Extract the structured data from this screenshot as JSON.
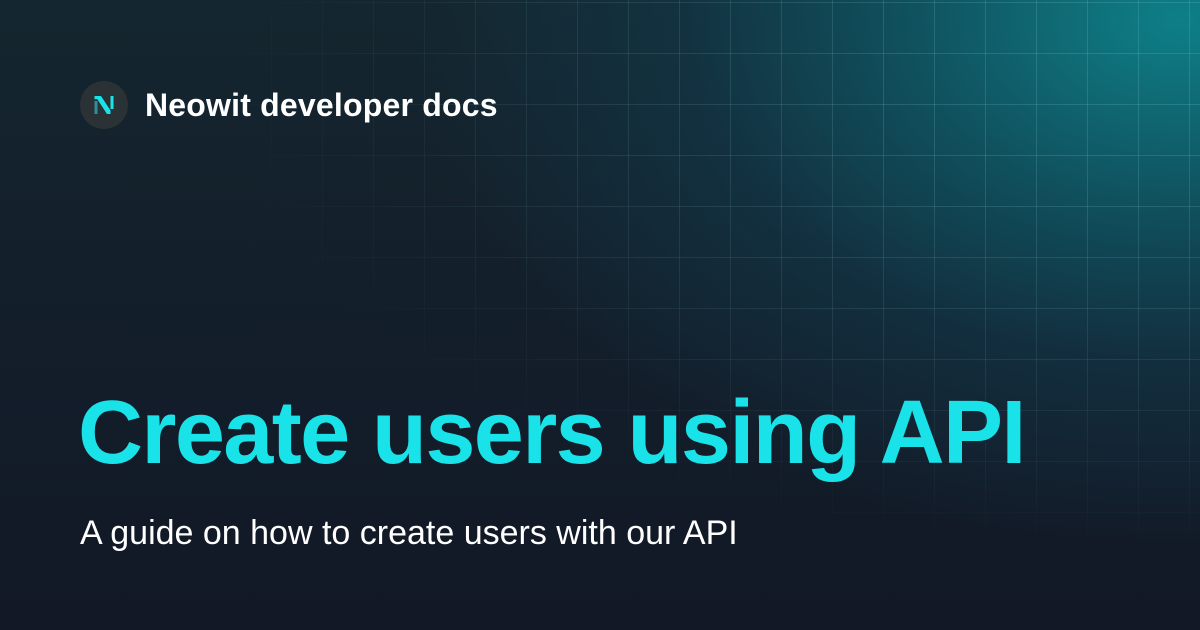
{
  "header": {
    "logo_icon": "neowit-logo-icon",
    "site_name": "Neowit developer docs"
  },
  "hero": {
    "title": "Create users using API",
    "subtitle": "A guide on how to create users with our API"
  },
  "colors": {
    "accent": "#19e3e8",
    "background": "#121a27",
    "glow": "#0e848c",
    "text": "#ffffff",
    "logo_badge": "#2b3236"
  }
}
